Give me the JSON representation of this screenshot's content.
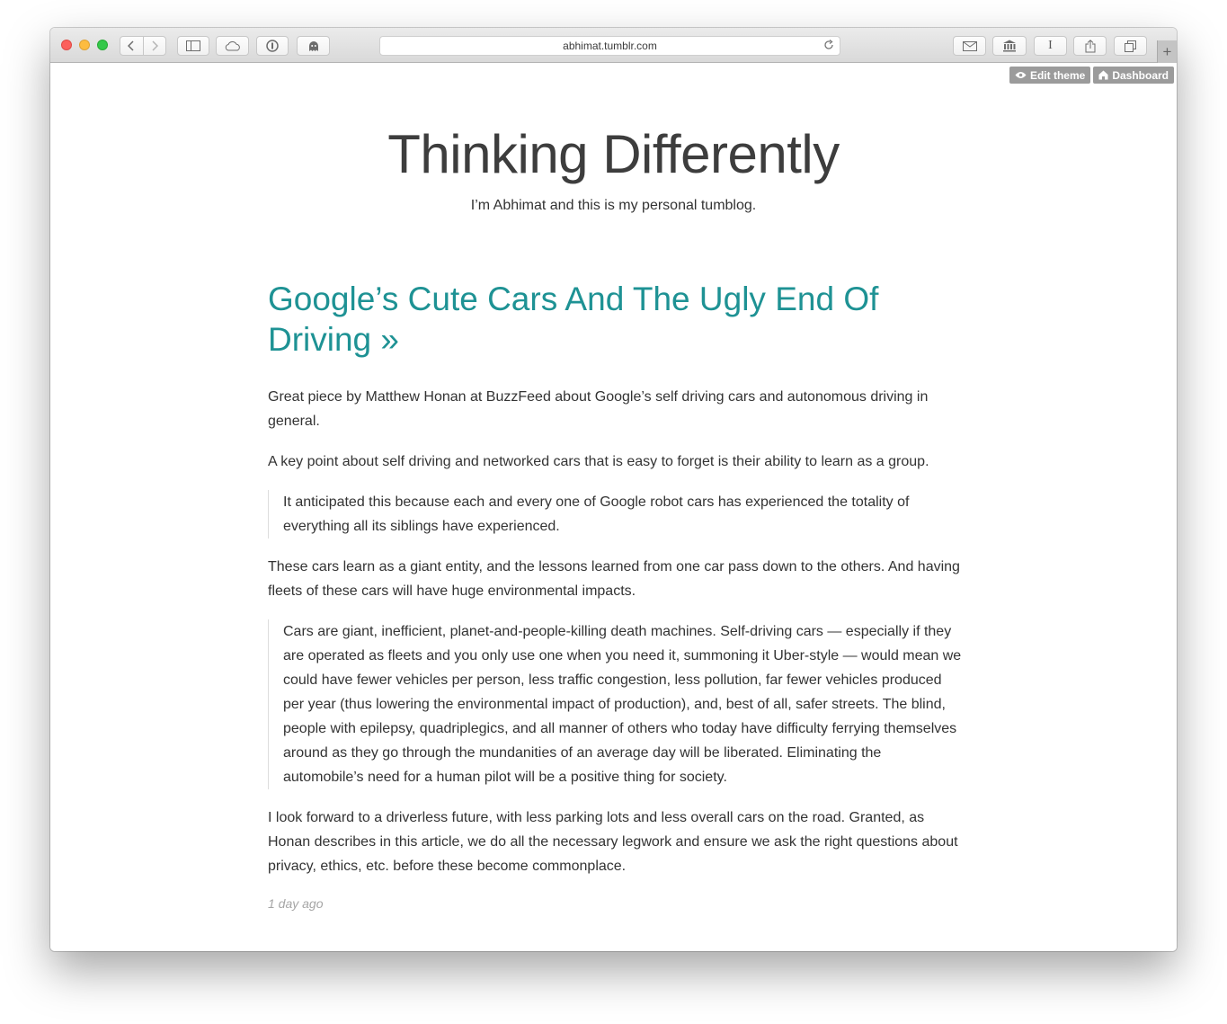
{
  "browser": {
    "url": "abhimat.tumblr.com",
    "icons": {
      "back": "chevron-left-icon",
      "forward": "chevron-right-icon",
      "sidebar": "sidebar-icon",
      "cloud": "icloud-tabs-icon",
      "password": "1password-icon",
      "ghostery": "ghost-icon",
      "reload": "reload-icon",
      "mail": "mail-icon",
      "library": "library-icon",
      "instapaper": "instapaper-icon",
      "share": "share-icon",
      "tabs": "tabs-overview-icon",
      "new_tab": "plus-icon"
    }
  },
  "tumblr_controls": {
    "edit_theme": "Edit theme",
    "dashboard": "Dashboard"
  },
  "blog": {
    "title": "Thinking Differently",
    "description": "I’m Abhimat and this is my personal tumblog."
  },
  "post": {
    "title": "Google’s Cute Cars And The Ugly End Of Driving »",
    "p1": "Great piece by Matthew Honan at BuzzFeed about Google’s self driving cars and autonomous driving in general.",
    "p2": "A key point about self driving and networked cars that is easy to forget is their ability to learn as a group.",
    "quote1": "It anticipated this because each and every one of Google robot cars has experienced the totality of everything all its siblings have experienced.",
    "p3": "These cars learn as a giant entity, and the lessons learned from one car pass down to the others. And having fleets of these cars will have huge environmental impacts.",
    "quote2": "Cars are giant, inefficient, planet-and-people-killing death machines. Self-driving cars — especially if they are operated as fleets and you only use one when you need it, summoning it Uber-style — would mean we could have fewer vehicles per person, less traffic congestion, less pollution, far fewer vehicles produced per year (thus lowering the environmental impact of production), and, best of all, safer streets. The blind, people with epilepsy, quadriplegics, and all manner of others who today have difficulty ferrying themselves around as they go through the mundanities of an average day will be liberated. Eliminating the automobile’s need for a human pilot will be a positive thing for society.",
    "p4": "I look forward to a driverless future, with less parking lots and less overall cars on the road. Granted, as Honan describes in this article, we do all the necessary legwork and ensure we ask the right questions about privacy, ethics, etc. before these become commonplace.",
    "date": "1 day ago"
  },
  "colors": {
    "post_title": "#1e9294",
    "blog_title": "#3d3d3d",
    "tumblr_button": "#9b9b9b"
  }
}
